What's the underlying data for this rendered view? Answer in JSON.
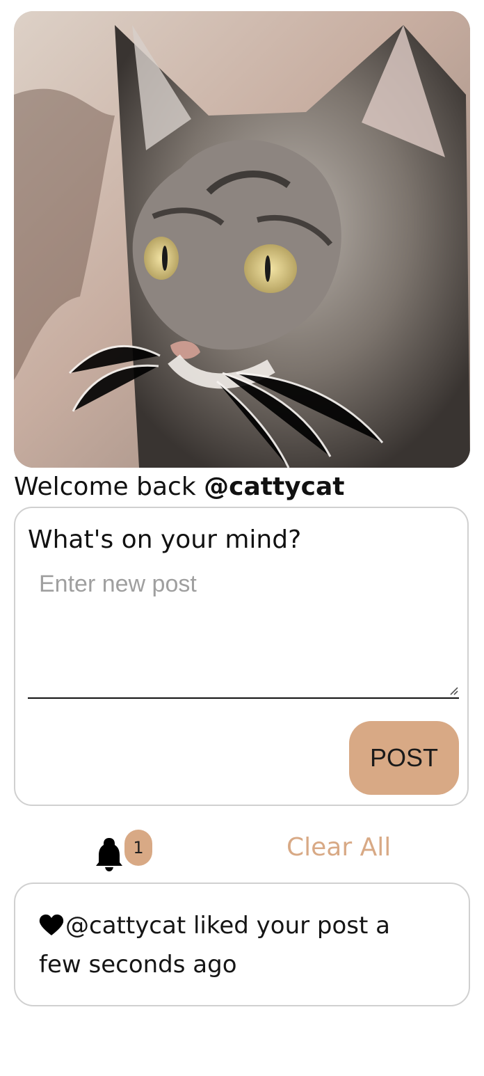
{
  "hero": {
    "alt": "tabby cat"
  },
  "welcome": {
    "prefix": "Welcome back ",
    "username": "@cattycat"
  },
  "composer": {
    "title": "What's on your mind?",
    "placeholder": "Enter new post",
    "value": "",
    "post_label": "POST"
  },
  "notifications": {
    "badge_count": "1",
    "clear_all_label": "Clear All",
    "items": [
      {
        "icon": "heart-icon",
        "text": "@cattycat liked your post a few seconds ago"
      }
    ]
  },
  "colors": {
    "accent": "#d8a985",
    "border": "#d0d0d0",
    "text": "#111111",
    "placeholder": "#9f9f9f"
  }
}
